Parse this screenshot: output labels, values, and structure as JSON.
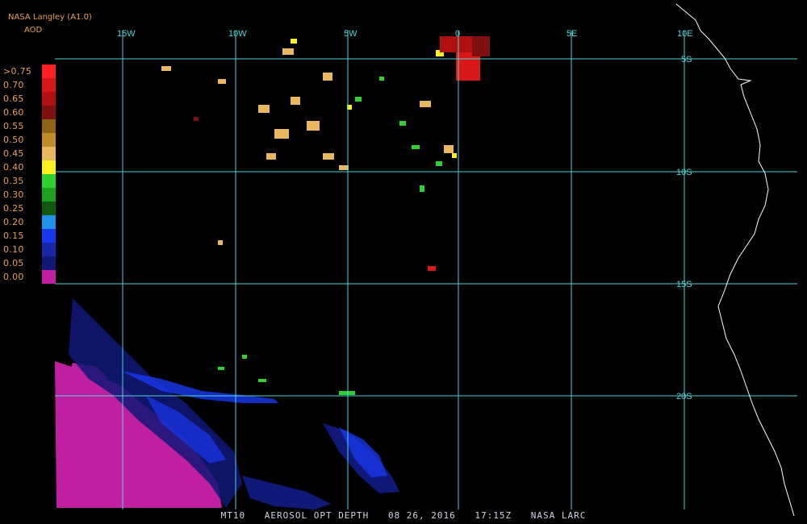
{
  "header": {
    "source": "NASA Langley (A1.0)",
    "product": "AOD"
  },
  "map": {
    "grid_color": "#4dd6d6",
    "coast_color": "#ffffff",
    "lon_labels": [
      "15W",
      "10W",
      "5W",
      "0",
      "5E",
      "10E"
    ],
    "lat_labels": [
      "5S",
      "10S",
      "15S",
      "20S"
    ]
  },
  "legend": {
    "items": [
      {
        "label": ">0.75",
        "color": "#ff2020"
      },
      {
        "label": "0.70",
        "color": "#d81818"
      },
      {
        "label": "0.65",
        "color": "#b01010"
      },
      {
        "label": "0.60",
        "color": "#801010"
      },
      {
        "label": "0.55",
        "color": "#8c6418"
      },
      {
        "label": "0.50",
        "color": "#c08c28"
      },
      {
        "label": "0.45",
        "color": "#e8b860"
      },
      {
        "label": "0.40",
        "color": "#f8f020"
      },
      {
        "label": "0.35",
        "color": "#30d030"
      },
      {
        "label": "0.30",
        "color": "#20a020"
      },
      {
        "label": "0.25",
        "color": "#105810"
      },
      {
        "label": "0.20",
        "color": "#2090e8"
      },
      {
        "label": "0.15",
        "color": "#1838f0"
      },
      {
        "label": "0.10",
        "color": "#1828a8"
      },
      {
        "label": "0.05",
        "color": "#101878"
      },
      {
        "label": "0.00",
        "color": "#c020a0"
      }
    ]
  },
  "footer": {
    "product_id": "MT10",
    "title": "AEROSOL OPT DEPTH",
    "date": "08 26, 2016",
    "time": "17:15Z",
    "agency": "NASA LARC"
  }
}
